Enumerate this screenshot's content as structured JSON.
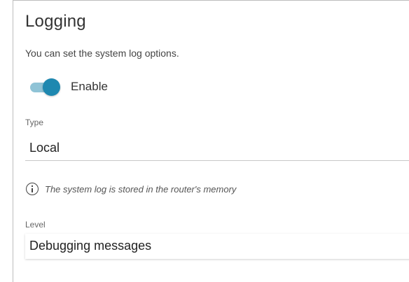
{
  "section": {
    "title": "Logging",
    "description": "You can set the system log options."
  },
  "enable_toggle": {
    "label": "Enable",
    "state": "on",
    "track_color": "#8fc3d6",
    "knob_color": "#1e88b0"
  },
  "type_field": {
    "label": "Type",
    "value": "Local"
  },
  "info": {
    "icon": "info-icon",
    "text": "The system log is stored in the router's memory"
  },
  "level_field": {
    "label": "Level",
    "value": "Debugging messages"
  }
}
